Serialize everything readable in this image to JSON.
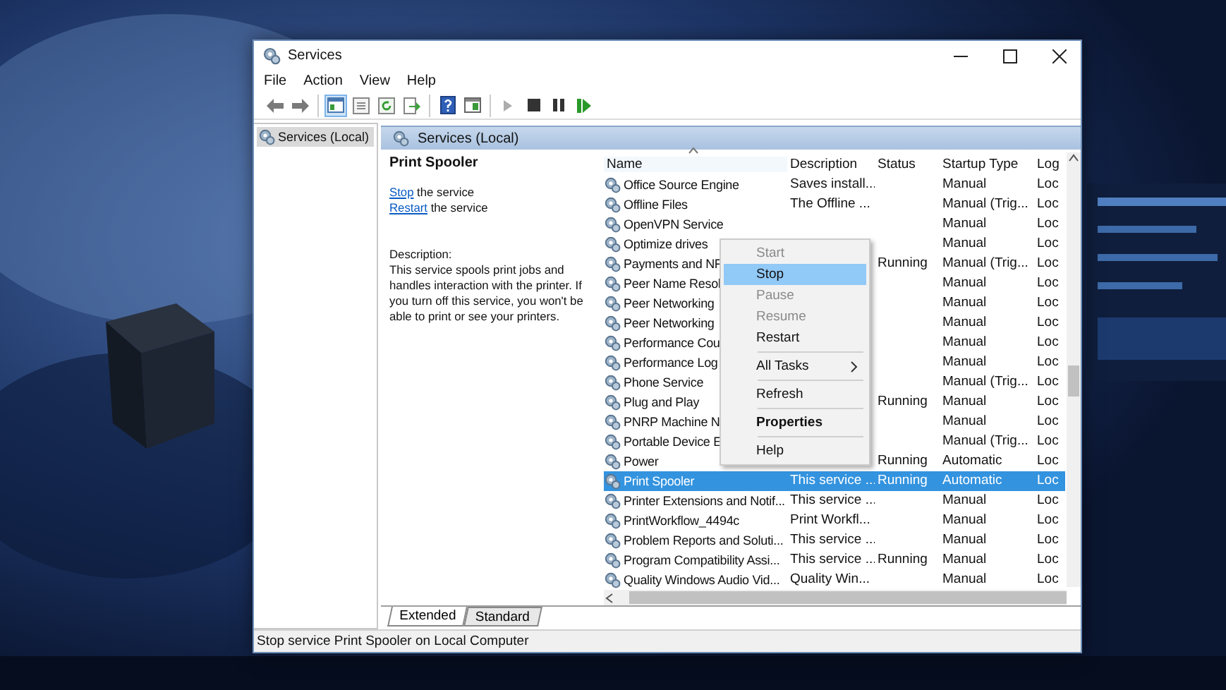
{
  "window": {
    "title": "Services"
  },
  "menu": [
    "File",
    "Action",
    "View",
    "Help"
  ],
  "toolbar": {
    "groups": [
      [
        {
          "kind": "back",
          "disabled": false,
          "pressed": false
        },
        {
          "kind": "forward",
          "disabled": false,
          "pressed": false
        }
      ],
      [
        {
          "kind": "tree",
          "disabled": false,
          "pressed": true
        },
        {
          "kind": "properties",
          "disabled": false,
          "pressed": false
        },
        {
          "kind": "refresh",
          "disabled": false,
          "pressed": false
        },
        {
          "kind": "export",
          "disabled": false,
          "pressed": false
        }
      ],
      [
        {
          "kind": "help",
          "disabled": false,
          "pressed": false
        },
        {
          "kind": "view",
          "disabled": false,
          "pressed": false
        }
      ],
      [
        {
          "kind": "play",
          "disabled": true,
          "pressed": false
        },
        {
          "kind": "stop",
          "disabled": false,
          "pressed": false
        },
        {
          "kind": "pause",
          "disabled": false,
          "pressed": false
        },
        {
          "kind": "resume",
          "disabled": false,
          "pressed": false
        }
      ]
    ]
  },
  "tree": [
    {
      "label": "Services (Local)",
      "selected": true
    }
  ],
  "panel": {
    "title": "Services (Local)"
  },
  "details": {
    "name": "Print Spooler",
    "actions": [
      {
        "link": "Stop",
        "text": " the service"
      },
      {
        "link": "Restart",
        "text": " the service"
      }
    ],
    "description_label": "Description:",
    "description": "This service spools print jobs and handles interaction with the printer. If you turn off this service, you won't be able to print or see your printers."
  },
  "columns": [
    {
      "label": "Name",
      "sorted": true
    },
    {
      "label": "Description",
      "sorted": false
    },
    {
      "label": "Status",
      "sorted": false
    },
    {
      "label": "Startup Type",
      "sorted": false
    },
    {
      "label": "Log",
      "sorted": false
    }
  ],
  "rows": [
    {
      "name": "Office Source Engine",
      "description": "Saves install...",
      "startup": "Manual",
      "log": "Loc",
      "selected": false
    },
    {
      "name": "Offline Files",
      "description": "The Offline ...",
      "startup": "Manual (Trig...",
      "log": "Loc",
      "selected": false
    },
    {
      "name": "OpenVPN Service",
      "startup": "Manual",
      "log": "Loc",
      "selected": false
    },
    {
      "name": "Optimize drives",
      "startup": "Manual",
      "log": "Loc",
      "selected": false
    },
    {
      "name": "Payments and NF",
      "status": "Running",
      "startup": "Manual (Trig...",
      "log": "Loc",
      "selected": false
    },
    {
      "name": "Peer Name Resol",
      "startup": "Manual",
      "log": "Loc",
      "selected": false
    },
    {
      "name": "Peer Networking",
      "startup": "Manual",
      "log": "Loc",
      "selected": false
    },
    {
      "name": "Peer Networking",
      "startup": "Manual",
      "log": "Loc",
      "selected": false
    },
    {
      "name": "Performance Cou",
      "startup": "Manual",
      "log": "Loc",
      "selected": false
    },
    {
      "name": "Performance Log",
      "startup": "Manual",
      "log": "Loc",
      "selected": false
    },
    {
      "name": "Phone Service",
      "startup": "Manual (Trig...",
      "log": "Loc",
      "selected": false
    },
    {
      "name": "Plug and Play",
      "status": "Running",
      "startup": "Manual",
      "log": "Loc",
      "selected": false
    },
    {
      "name": "PNRP Machine N",
      "startup": "Manual",
      "log": "Loc",
      "selected": false
    },
    {
      "name": "Portable Device E",
      "startup": "Manual (Trig...",
      "log": "Loc",
      "selected": false
    },
    {
      "name": "Power",
      "status": "Running",
      "startup": "Automatic",
      "log": "Loc",
      "selected": false
    },
    {
      "name": "Print Spooler",
      "description": "This service ...",
      "status": "Running",
      "startup": "Automatic",
      "log": "Loc",
      "selected": true
    },
    {
      "name": "Printer Extensions and Notif...",
      "description": "This service ...",
      "startup": "Manual",
      "log": "Loc",
      "selected": false
    },
    {
      "name": "PrintWorkflow_4494c",
      "description": "Print Workfl...",
      "startup": "Manual",
      "log": "Loc",
      "selected": false
    },
    {
      "name": "Problem Reports and Soluti...",
      "description": "This service ...",
      "startup": "Manual",
      "log": "Loc",
      "selected": false
    },
    {
      "name": "Program Compatibility Assi...",
      "description": "This service ...",
      "status": "Running",
      "startup": "Manual",
      "log": "Loc",
      "selected": false
    },
    {
      "name": "Quality Windows Audio Vid...",
      "description": "Quality Win...",
      "startup": "Manual",
      "log": "Loc",
      "selected": false
    }
  ],
  "context_menu": {
    "groups": [
      [
        {
          "label": "Start",
          "disabled": true,
          "selected": false,
          "default": false,
          "submenu": false
        },
        {
          "label": "Stop",
          "disabled": false,
          "selected": true,
          "default": false,
          "submenu": false
        },
        {
          "label": "Pause",
          "disabled": true,
          "selected": false,
          "default": false,
          "submenu": false
        },
        {
          "label": "Resume",
          "disabled": true,
          "selected": false,
          "default": false,
          "submenu": false
        },
        {
          "label": "Restart",
          "disabled": false,
          "selected": false,
          "default": false,
          "submenu": false
        }
      ],
      [
        {
          "label": "All Tasks",
          "disabled": false,
          "selected": false,
          "default": false,
          "submenu": true
        }
      ],
      [
        {
          "label": "Refresh",
          "disabled": false,
          "selected": false,
          "default": false,
          "submenu": false
        }
      ],
      [
        {
          "label": "Properties",
          "disabled": false,
          "selected": false,
          "default": true,
          "submenu": false
        }
      ],
      [
        {
          "label": "Help",
          "disabled": false,
          "selected": false,
          "default": false,
          "submenu": false
        }
      ]
    ]
  },
  "view_tabs": [
    {
      "label": "Extended",
      "selected": true
    },
    {
      "label": "Standard",
      "selected": false
    }
  ],
  "status_bar": "Stop service Print Spooler on Local Computer"
}
